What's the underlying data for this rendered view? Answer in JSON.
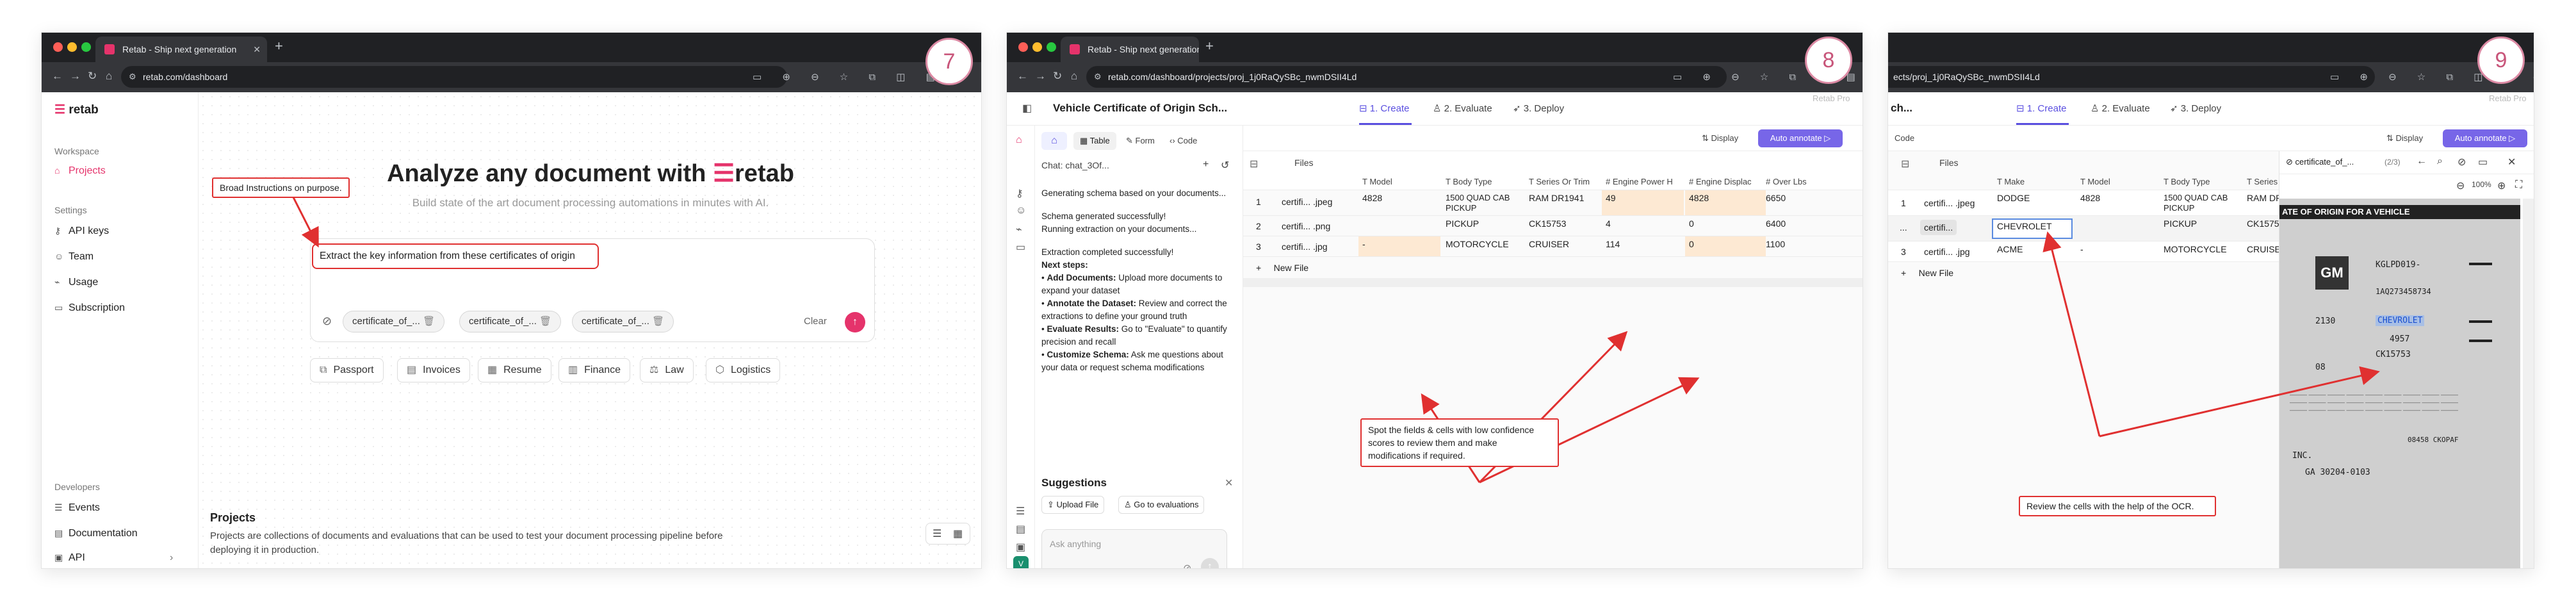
{
  "colors": {
    "brand": "#e5336b",
    "accent": "#7766e8",
    "annotation": "#e03030",
    "highlight": "#fde9d3",
    "badge": "#c8557a"
  },
  "panel1": {
    "step": "7",
    "tab_title": "Retab - Ship next generation",
    "url": "retab.com/dashboard",
    "logo": "retab",
    "sidebar": {
      "workspace_label": "Workspace",
      "projects": "Projects",
      "settings_label": "Settings",
      "api_keys": "API keys",
      "team": "Team",
      "usage": "Usage",
      "subscription": "Subscription",
      "developers_label": "Developers",
      "events": "Events",
      "documentation": "Documentation",
      "api": "API"
    },
    "hero_title_prefix": "Analyze any document with",
    "hero_title_brand": "retab",
    "hero_subtitle": "Build state of the art document processing automations in minutes with AI.",
    "annotation": "Broad Instructions on purpose.",
    "prompt_text": "Extract the key information from these certificates of origin",
    "attachments": [
      "certificate_of_...",
      "certificate_of_...",
      "certificate_of_..."
    ],
    "clear_label": "Clear",
    "categories": [
      "Passport",
      "Invoices",
      "Resume",
      "Finance",
      "Law",
      "Logistics"
    ],
    "projects_title": "Projects",
    "projects_desc": "Projects are collections of documents and evaluations that can be used to test your document processing pipeline before deploying it in production."
  },
  "panel2": {
    "step": "8",
    "tab_title": "Retab - Ship next generation",
    "url": "retab.com/dashboard/projects/proj_1j0RaQySBc_nwmDSII4Ld",
    "project_title": "Vehicle Certificate of Origin Sch...",
    "tabs": [
      "1. Create",
      "2. Evaluate",
      "3. Deploy"
    ],
    "retab_pro": "Retab Pro",
    "views": [
      "Table",
      "Form",
      "Code"
    ],
    "display_label": "Display",
    "auto_annotate": "Auto annotate",
    "chat_title": "Chat: chat_3Of...",
    "chat_lines": [
      "Generating schema based on your documents...",
      "Schema generated successfully!",
      "Running extraction on your documents...",
      "Extraction completed successfully!",
      "Next steps:"
    ],
    "next_steps": [
      {
        "bold": "Add Documents:",
        "text": " Upload more documents to expand your dataset"
      },
      {
        "bold": "Annotate the Dataset:",
        "text": " Review and correct the extractions to define your ground truth"
      },
      {
        "bold": "Evaluate Results:",
        "text": " Go to \"Evaluate\" to quantify precision and recall"
      },
      {
        "bold": "Customize Schema:",
        "text": " Ask me questions about your data or request schema modifications"
      }
    ],
    "suggestions_title": "Suggestions",
    "suggestions": [
      "Upload File",
      "Go to evaluations"
    ],
    "ask_placeholder": "Ask anything",
    "files_label": "Files",
    "columns": [
      "Model",
      "Body Type",
      "Series Or Trim",
      "Engine Power H",
      "Engine Displac",
      "Over Lbs"
    ],
    "rows": [
      {
        "n": "1",
        "file": "certifi... .jpeg",
        "cells": [
          "4828",
          "1500 QUAD CAB PICKUP",
          "RAM DR1941",
          "49",
          "4828",
          "6650"
        ]
      },
      {
        "n": "2",
        "file": "certifi... .png",
        "cells": [
          "",
          "PICKUP",
          "CK15753",
          "4",
          "0",
          "6400"
        ]
      },
      {
        "n": "3",
        "file": "certifi... .jpg",
        "cells": [
          "-",
          "MOTORCYCLE",
          "CRUISER",
          "114",
          "0",
          "1100"
        ]
      }
    ],
    "new_file": "New File",
    "annotation": "Spot the fields & cells with low confidence scores to review them and make modifications if required."
  },
  "panel3": {
    "step": "9",
    "url": "ects/proj_1j0RaQySBc_nwmDSII4Ld",
    "title_fragment": "ch...",
    "tabs": [
      "1. Create",
      "2. Evaluate",
      "3. Deploy"
    ],
    "retab_pro": "Retab Pro",
    "code_label": "Code",
    "display_label": "Display",
    "auto_annotate": "Auto annotate",
    "files_label": "Files",
    "columns": [
      "Make",
      "Model",
      "Body Type",
      "Series O"
    ],
    "rows": [
      {
        "n": "1",
        "file": "certifi... .jpeg",
        "cells": [
          "DODGE",
          "4828",
          "1500 QUAD CAB PICKUP",
          "RAM DR"
        ]
      },
      {
        "n": "...",
        "file": "certifi...",
        "cells": [
          "CHEVROLET",
          "",
          "PICKUP",
          "CK1575"
        ]
      },
      {
        "n": "3",
        "file": "certifi... .jpg",
        "cells": [
          "ACME",
          "-",
          "MOTORCYCLE",
          "CRUISE"
        ]
      }
    ],
    "new_file": "New File",
    "doc_name": "certificate_of_...",
    "doc_pages": "(2/3)",
    "zoom": "100%",
    "annotation": "Review the cells with the help of the OCR.",
    "doc_banner": "ATE OF ORIGIN FOR A VEHICLE",
    "doc_lines": [
      "KGLPD019-",
      "1AQ273458734",
      "CHEVROLET",
      "2130",
      "4957",
      "CK15753",
      "08",
      "INC.",
      "GA  30204-0103",
      "08458 CKOPAF"
    ],
    "doc_brand": "GM"
  }
}
